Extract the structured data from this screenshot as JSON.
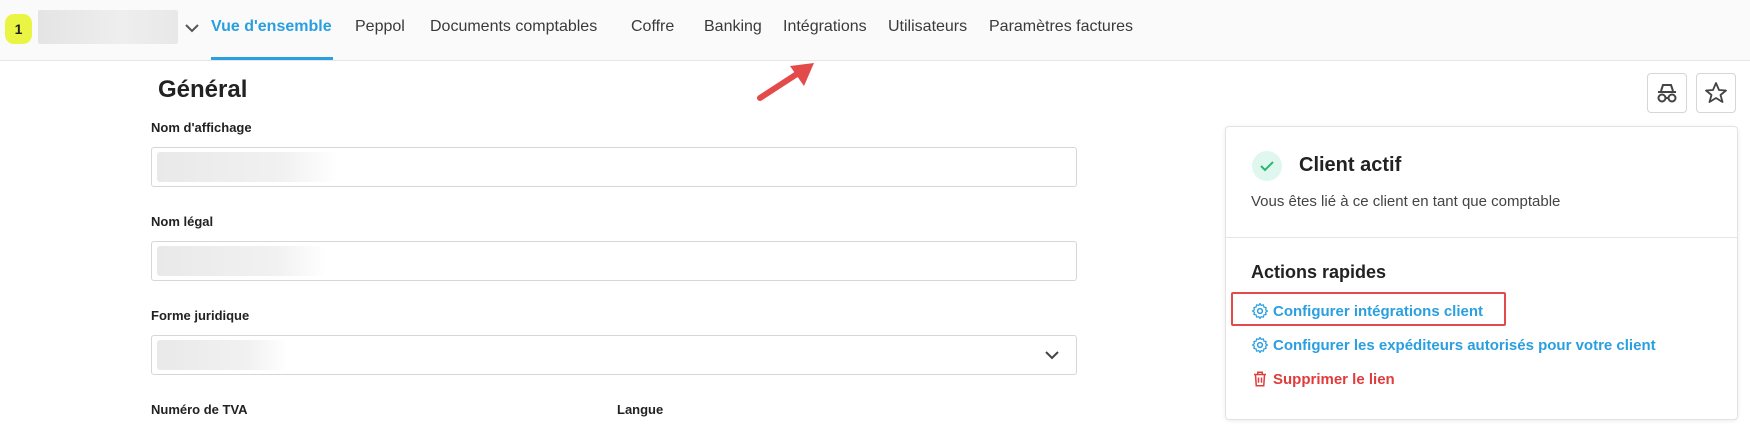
{
  "topbar": {
    "badge": "1",
    "nav": [
      {
        "label": "Vue d'ensemble",
        "active": true
      },
      {
        "label": "Peppol"
      },
      {
        "label": "Documents comptables"
      },
      {
        "label": "Coffre"
      },
      {
        "label": "Banking"
      },
      {
        "label": "Intégrations"
      },
      {
        "label": "Utilisateurs"
      },
      {
        "label": "Paramètres factures"
      }
    ]
  },
  "form": {
    "title": "Général",
    "fields": {
      "display_name": "Nom d'affichage",
      "legal_name": "Nom légal",
      "legal_form": "Forme juridique",
      "vat_number": "Numéro de TVA",
      "language": "Langue"
    }
  },
  "panel": {
    "status_title": "Client actif",
    "status_desc": "Vous êtes lié à ce client en tant que comptable",
    "quick_actions_title": "Actions rapides",
    "actions": [
      {
        "label": "Configurer intégrations client",
        "icon": "gear-icon"
      },
      {
        "label": "Configurer les expéditeurs autorisés pour votre client",
        "icon": "gear-icon"
      },
      {
        "label": "Supprimer le lien",
        "icon": "trash-icon"
      }
    ]
  },
  "colors": {
    "accent": "#2a9fe0",
    "danger": "#e03c3c",
    "badge": "#e9f542",
    "annotation": "#e34b4b"
  }
}
